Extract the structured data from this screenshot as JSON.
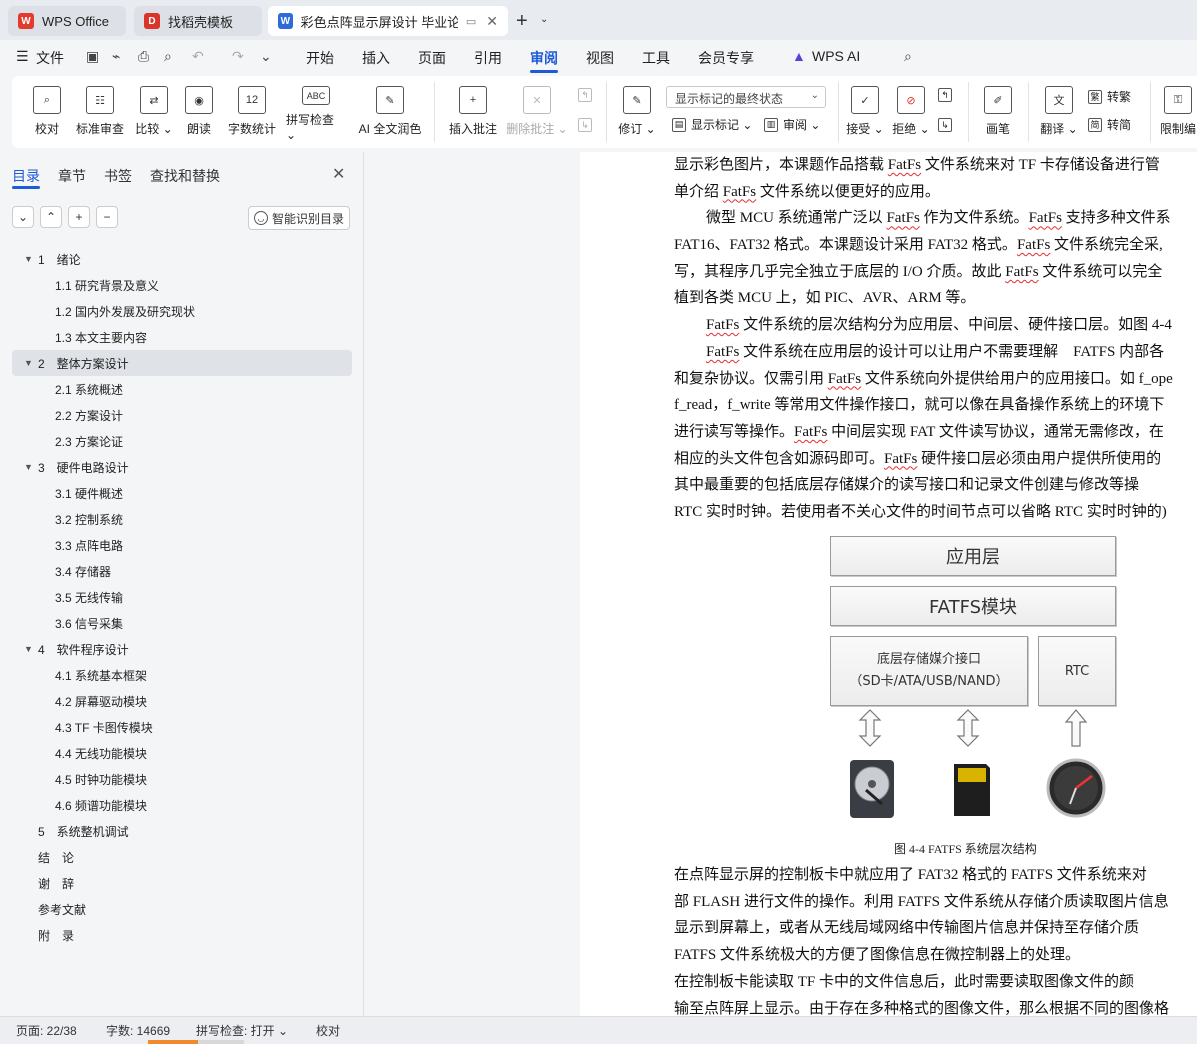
{
  "tabs": [
    {
      "label": "WPS Office"
    },
    {
      "label": "找稻壳模板"
    },
    {
      "label": "彩色点阵显示屏设计 毕业论文"
    }
  ],
  "menu": {
    "file": "文件",
    "items": [
      "开始",
      "插入",
      "页面",
      "引用",
      "审阅",
      "视图",
      "工具",
      "会员专享",
      "WPS AI"
    ],
    "active": "审阅"
  },
  "ribbon": {
    "proofread": "校对",
    "standard_review": "标准审查",
    "compare": "比较",
    "read_aloud": "朗读",
    "word_count": "字数统计",
    "spell_check": "拼写检查",
    "ai_polish": "AI 全文润色",
    "insert_comment": "插入批注",
    "delete_comment": "删除批注",
    "track_changes": "修订",
    "markup_display_select": "显示标记的最终状态",
    "show_markup": "显示标记",
    "review": "审阅",
    "accept": "接受",
    "reject": "拒绝",
    "pen": "画笔",
    "translate": "翻译",
    "to_traditional": "转繁",
    "to_simplified": "转简",
    "restrict_edit": "限制编"
  },
  "left_panel": {
    "tabs": [
      "目录",
      "章节",
      "书签",
      "查找和替换"
    ],
    "smart_toc": "智能识别目录",
    "toc": [
      {
        "label": "1　绪论",
        "level": 1,
        "sel": false
      },
      {
        "label": "1.1 研究背景及意义",
        "level": 2,
        "sel": false
      },
      {
        "label": "1.2 国内外发展及研究现状",
        "level": 2,
        "sel": false
      },
      {
        "label": "1.3 本文主要内容",
        "level": 2,
        "sel": false
      },
      {
        "label": "2　整体方案设计",
        "level": 1,
        "sel": true
      },
      {
        "label": "2.1 系统概述",
        "level": 2,
        "sel": false
      },
      {
        "label": "2.2 方案设计",
        "level": 2,
        "sel": false
      },
      {
        "label": "2.3 方案论证",
        "level": 2,
        "sel": false
      },
      {
        "label": "3　硬件电路设计",
        "level": 1,
        "sel": false
      },
      {
        "label": "3.1 硬件概述",
        "level": 2,
        "sel": false
      },
      {
        "label": "3.2 控制系统",
        "level": 2,
        "sel": false
      },
      {
        "label": "3.3 点阵电路",
        "level": 2,
        "sel": false
      },
      {
        "label": "3.4 存储器",
        "level": 2,
        "sel": false
      },
      {
        "label": "3.5 无线传输",
        "level": 2,
        "sel": false
      },
      {
        "label": "3.6 信号采集",
        "level": 2,
        "sel": false
      },
      {
        "label": "4　软件程序设计",
        "level": 1,
        "sel": false
      },
      {
        "label": "4.1 系统基本框架",
        "level": 2,
        "sel": false
      },
      {
        "label": "4.2 屏幕驱动模块",
        "level": 2,
        "sel": false
      },
      {
        "label": "4.3 TF 卡图传模块",
        "level": 2,
        "sel": false
      },
      {
        "label": "4.4 无线功能模块",
        "level": 2,
        "sel": false
      },
      {
        "label": "4.5 时钟功能模块",
        "level": 2,
        "sel": false
      },
      {
        "label": "4.6 频谱功能模块",
        "level": 2,
        "sel": false
      },
      {
        "label": "5　系统整机调试",
        "level": 0,
        "sel": false
      },
      {
        "label": "结　论",
        "level": 0,
        "sel": false
      },
      {
        "label": "谢　辞",
        "level": 0,
        "sel": false
      },
      {
        "label": "参考文献",
        "level": 0,
        "sel": false
      },
      {
        "label": "附　录",
        "level": 0,
        "sel": false
      }
    ]
  },
  "document": {
    "lines": [
      {
        "indent": false,
        "parts": [
          {
            "t": "显示彩色图片，本课题作品搭载 "
          },
          {
            "t": "FatFs",
            "sq": true
          },
          {
            "t": " 文件系统来对 TF 卡存储设备进行管"
          }
        ]
      },
      {
        "indent": false,
        "parts": [
          {
            "t": "单介绍 "
          },
          {
            "t": "FatFs",
            "sq": true
          },
          {
            "t": " 文件系统以便更好的应用。"
          }
        ]
      },
      {
        "indent": true,
        "parts": [
          {
            "t": "微型 MCU 系统通常广泛以 "
          },
          {
            "t": "FatFs",
            "sq": true
          },
          {
            "t": " 作为文件系统。"
          },
          {
            "t": "FatFs",
            "sq": true
          },
          {
            "t": " 支持多种文件系"
          }
        ]
      },
      {
        "indent": false,
        "parts": [
          {
            "t": "FAT16、FAT32 格式。本课题设计采用 FAT32 格式。"
          },
          {
            "t": "FatFs",
            "sq": true
          },
          {
            "t": " 文件系统完全采,"
          }
        ]
      },
      {
        "indent": false,
        "parts": [
          {
            "t": "写，其程序几乎完全独立于底层的 I/O 介质。故此 "
          },
          {
            "t": "FatFs",
            "sq": true
          },
          {
            "t": " 文件系统可以完全"
          }
        ]
      },
      {
        "indent": false,
        "parts": [
          {
            "t": "植到各类 MCU 上，如 PIC、AVR、ARM 等。"
          }
        ]
      },
      {
        "indent": true,
        "parts": [
          {
            "t": "FatFs",
            "sq": true
          },
          {
            "t": " 文件系统的层次结构分为应用层、中间层、硬件接口层。如图 4-4"
          }
        ]
      },
      {
        "indent": true,
        "parts": [
          {
            "t": "FatFs",
            "sq": true
          },
          {
            "t": " 文件系统在应用层的设计可以让用户不需要理解　FATFS 内部各"
          }
        ]
      },
      {
        "indent": false,
        "parts": [
          {
            "t": "和复杂协议。仅需引用 "
          },
          {
            "t": "FatFs",
            "sq": true
          },
          {
            "t": " 文件系统向外提供给用户的应用接口。如 f_ope"
          }
        ]
      },
      {
        "indent": false,
        "parts": [
          {
            "t": "f_read，f_write 等常用文件操作接口，就可以像在具备操作系统上的环境下"
          }
        ]
      },
      {
        "indent": false,
        "parts": [
          {
            "t": "进行读写等操作。"
          },
          {
            "t": "FatFs",
            "sq": true
          },
          {
            "t": " 中间层实现 FAT 文件读写协议，通常无需修改，在"
          }
        ]
      },
      {
        "indent": false,
        "parts": [
          {
            "t": "相应的头文件包含如源码即可。"
          },
          {
            "t": "FatFs",
            "sq": true
          },
          {
            "t": " 硬件接口层必须由用户提供所使用的"
          }
        ]
      },
      {
        "indent": false,
        "parts": [
          {
            "t": "其中最重要的包括底层存储媒介的读写接口和记录文件创建与修改等操"
          }
        ]
      },
      {
        "indent": false,
        "parts": [
          {
            "t": "RTC 实时时钟。若使用者不关心文件的时间节点可以省略 RTC 实时时钟的)"
          }
        ]
      }
    ],
    "figure": {
      "app_layer": "应用层",
      "fatfs_module": "FATFS模块",
      "storage_iface_line1": "底层存储媒介接口",
      "storage_iface_line2": "（SD卡/ATA/USB/NAND）",
      "rtc": "RTC",
      "caption": "图 4-4 FATFS 系统层次结构"
    },
    "lines2": [
      {
        "indent": true,
        "parts": [
          {
            "t": "在点阵显示屏的控制板卡中就应用了 FAT32 格式的 FATFS 文件系统来对"
          }
        ]
      },
      {
        "indent": false,
        "parts": [
          {
            "t": "部 FLASH 进行文件的操作。利用 FATFS 文件系统从存储介质读取图片信息"
          }
        ]
      },
      {
        "indent": false,
        "parts": [
          {
            "t": "显示到屏幕上，或者从无线局域网络中传输图片信息并保持至存储介质"
          }
        ]
      },
      {
        "indent": false,
        "parts": [
          {
            "t": "FATFS 文件系统极大的方便了图像信息在微控制器上的处理。"
          }
        ]
      },
      {
        "indent": true,
        "parts": [
          {
            "t": "在控制板卡能读取 TF 卡中的文件信息后，此时需要读取图像文件的颜"
          }
        ]
      },
      {
        "indent": false,
        "parts": [
          {
            "t": "输至点阵屏上显示。由于存在多种格式的图像文件，那么根据不同的图像格"
          }
        ]
      }
    ]
  },
  "status": {
    "page": "页面: 22/38",
    "words": "字数: 14669",
    "spell": "拼写检查: 打开",
    "proof": "校对"
  }
}
